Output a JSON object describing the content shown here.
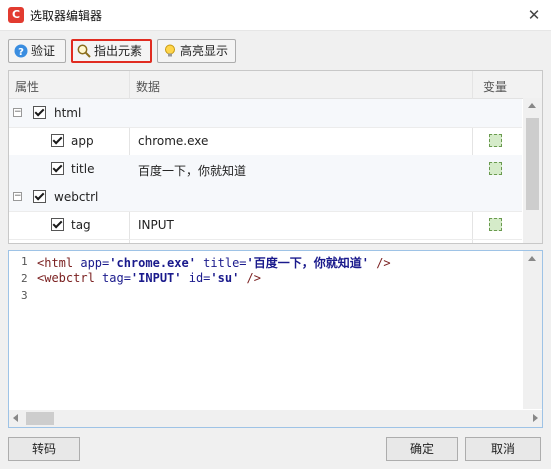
{
  "window": {
    "title": "选取器编辑器",
    "app_icon": "C",
    "close": "✕"
  },
  "toolbar": {
    "validate_label": "验证",
    "pick_label": "指出元素",
    "highlight_label": "高亮显示"
  },
  "grid": {
    "headers": {
      "attribute": "属性",
      "data": "数据",
      "variable": "变量"
    },
    "rows": [
      {
        "name": "html",
        "value": ""
      },
      {
        "name": "app",
        "value": "chrome.exe"
      },
      {
        "name": "title",
        "value": "百度一下，你就知道"
      },
      {
        "name": "webctrl",
        "value": ""
      },
      {
        "name": "tag",
        "value": "INPUT"
      }
    ]
  },
  "editor": {
    "line_numbers": [
      "1",
      "2",
      "3"
    ],
    "line1": {
      "open": "<html",
      "a1": " app=",
      "v1": "'chrome.exe'",
      "a2": " title=",
      "v2": "'百度一下，你就知道'",
      "close": " />"
    },
    "line2": {
      "open": "<webctrl",
      "a1": " tag=",
      "v1": "'INPUT'",
      "a2": " id=",
      "v2": "'su'",
      "close": " />"
    }
  },
  "footer": {
    "transcode_label": "转码",
    "ok_label": "确定",
    "cancel_label": "取消"
  },
  "colors": {
    "accent_red": "#e02b20",
    "tag": "#7a1f1f",
    "attr": "#1a1a8c"
  }
}
